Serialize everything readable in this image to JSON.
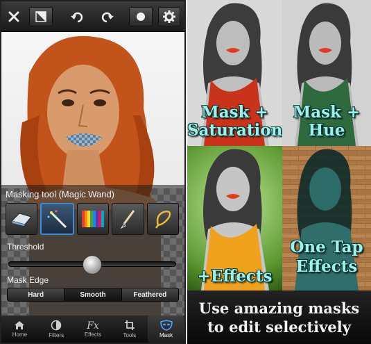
{
  "editor": {
    "panel": {
      "title": "Masking tool  (Magic Wand)",
      "threshold_label": "Threshold",
      "threshold_value": 0.5,
      "mask_edge_label": "Mask Edge",
      "edge_options": [
        "Hard",
        "Smooth",
        "Feathered"
      ],
      "edge_selected": "Smooth",
      "tools": [
        "eraser-icon",
        "magic-wand-icon",
        "color-swatches-icon",
        "brush-icon",
        "lasso-icon"
      ],
      "selected_tool": "magic-wand-icon"
    },
    "tabs": [
      {
        "label": "Home",
        "icon": "home-icon"
      },
      {
        "label": "Filters",
        "icon": "filters-icon"
      },
      {
        "label": "Effects",
        "icon": "fx-icon"
      },
      {
        "label": "Tools",
        "icon": "crop-icon"
      },
      {
        "label": "Mask",
        "icon": "mask-icon"
      }
    ],
    "active_tab": "Mask",
    "fx_glyph": "Fx"
  },
  "showcase": {
    "tiles": [
      {
        "caption_lines": [
          "Mask +",
          "Saturation"
        ]
      },
      {
        "caption_lines": [
          "Mask +",
          "Hue"
        ]
      },
      {
        "caption_lines": [
          "+Effects"
        ]
      },
      {
        "caption_lines": [
          "One Tap",
          "Effects"
        ]
      }
    ],
    "banner_lines": [
      "Use amazing masks",
      "to edit selectively"
    ]
  },
  "colors": {
    "caption": "#9ef0ea",
    "selection": "#3a8dde",
    "lips_mask": "#e23a22"
  }
}
